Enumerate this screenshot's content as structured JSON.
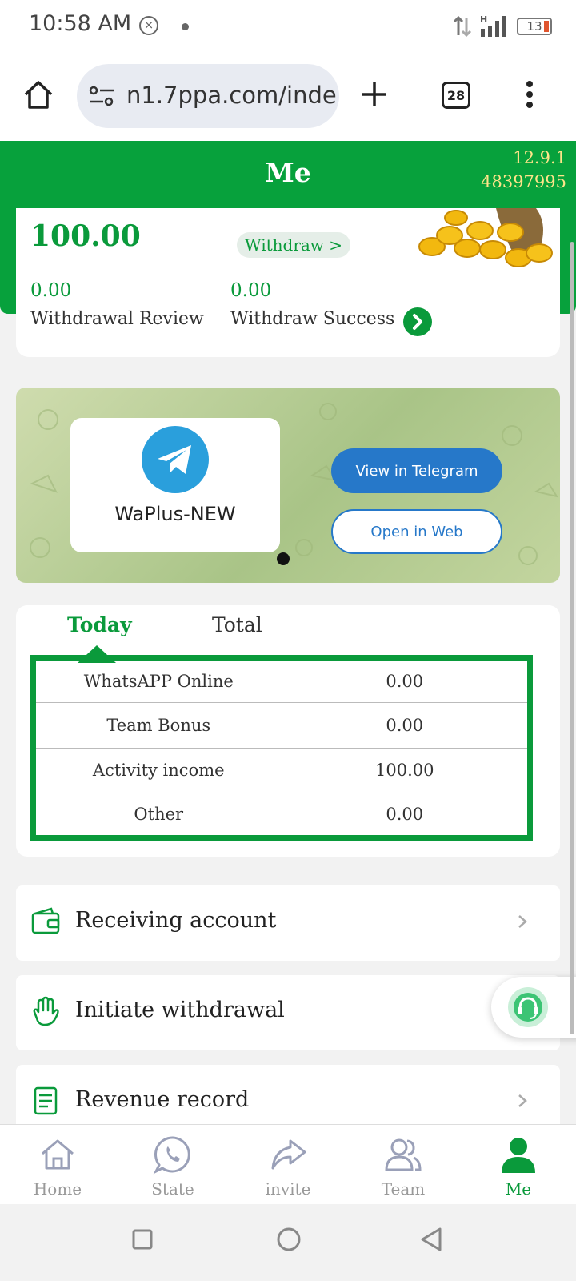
{
  "status_bar": {
    "time": "10:58 AM",
    "network": "H",
    "battery": "13"
  },
  "browser": {
    "url": "n1.7ppa.com/inde",
    "tab_count": "28"
  },
  "header": {
    "title": "Me",
    "version_line1": "12.9.1",
    "version_line2": "48397995"
  },
  "balance": {
    "amount": "100.00",
    "withdraw_label": "Withdraw >",
    "review_value": "0.00",
    "review_label": "Withdrawal Review",
    "success_value": "0.00",
    "success_label": "Withdraw Success"
  },
  "banner": {
    "channel_name": "WaPlus-NEW",
    "view_button": "View in Telegram",
    "web_button": "Open in Web"
  },
  "stats": {
    "tabs": [
      "Today",
      "Total"
    ],
    "rows": [
      {
        "label": "WhatsAPP Online",
        "value": "0.00"
      },
      {
        "label": "Team Bonus",
        "value": "0.00"
      },
      {
        "label": "Activity income",
        "value": "100.00"
      },
      {
        "label": "Other",
        "value": "0.00"
      }
    ]
  },
  "menu": [
    {
      "label": "Receiving account",
      "icon": "wallet-icon"
    },
    {
      "label": "Initiate withdrawal",
      "icon": "hand-icon"
    },
    {
      "label": "Revenue record",
      "icon": "document-icon"
    }
  ],
  "bottom_nav": [
    {
      "label": "Home",
      "icon": "home-icon"
    },
    {
      "label": "State",
      "icon": "whatsapp-icon"
    },
    {
      "label": "invite",
      "icon": "share-icon"
    },
    {
      "label": "Team",
      "icon": "team-icon"
    },
    {
      "label": "Me",
      "icon": "person-icon",
      "active": true
    }
  ],
  "colors": {
    "brand_green": "#07a13c",
    "telegram_blue": "#2678c9",
    "version_yellow": "#ffe58a"
  }
}
